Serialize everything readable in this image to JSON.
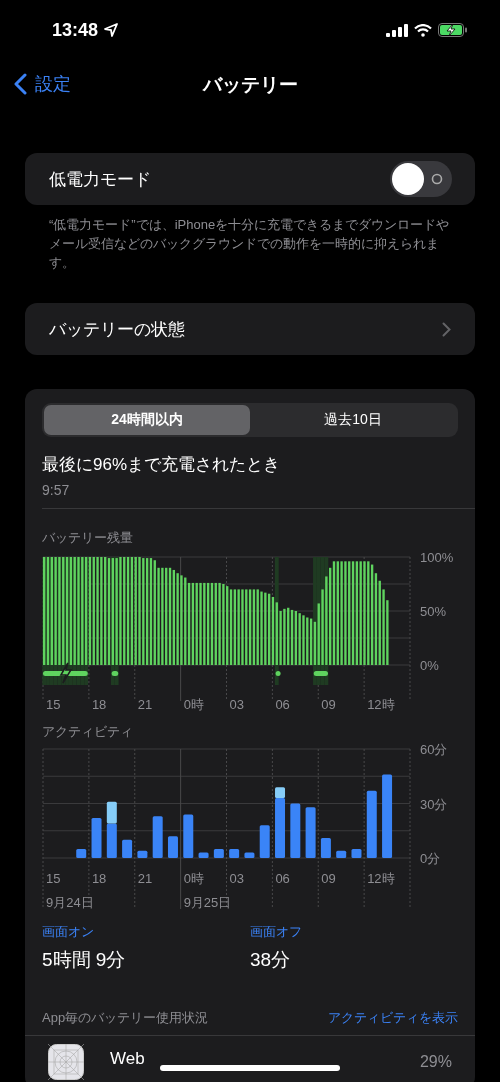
{
  "status_bar": {
    "time": "13:48"
  },
  "nav": {
    "back_label": "設定",
    "title": "バッテリー"
  },
  "low_power_mode": {
    "label": "低電力モード",
    "on": false,
    "footnote": "“低電力モード”では、iPhoneを十分に充電できるまでダウンロードやメール受信などのバックグラウンドでの動作を一時的に抑えられます。"
  },
  "battery_health": {
    "label": "バッテリーの状態"
  },
  "usage": {
    "tabs": [
      {
        "label": "24時間以内",
        "selected": true
      },
      {
        "label": "過去10日",
        "selected": false
      }
    ],
    "last_charged": {
      "title": "最後に96%まで充電されたとき",
      "time": "9:57"
    },
    "battery_level": {
      "title": "バッテリー残量",
      "x_labels": [
        "15",
        "18",
        "21",
        "0時",
        "03",
        "06",
        "09",
        "12時"
      ],
      "chart_data": {
        "type": "bar",
        "color": "#5fd35f",
        "values": [
          100,
          100,
          100,
          100,
          100,
          100,
          100,
          100,
          100,
          100,
          100,
          100,
          100,
          100,
          100,
          100,
          100,
          99,
          99,
          99,
          100,
          100,
          100,
          100,
          100,
          100,
          99,
          99,
          99,
          97,
          90,
          90,
          90,
          90,
          88,
          85,
          83,
          81,
          76,
          76,
          76,
          76,
          76,
          76,
          76,
          76,
          76,
          75,
          73,
          70,
          70,
          70,
          70,
          70,
          70,
          70,
          70,
          68,
          67,
          66,
          63,
          58,
          50,
          52,
          53,
          51,
          50,
          48,
          46,
          44,
          43,
          40,
          57,
          70,
          82,
          90,
          96,
          96,
          96,
          96,
          96,
          96,
          96,
          96,
          96,
          96,
          93,
          85,
          78,
          70,
          60
        ],
        "ylim": [
          0,
          100
        ],
        "yticks": [
          {
            "value": 0,
            "label": "0%"
          },
          {
            "value": 50,
            "label": "50%"
          },
          {
            "value": 100,
            "label": "100%"
          }
        ]
      },
      "charging": [
        true,
        true,
        true,
        true,
        true,
        true,
        true,
        true,
        true,
        true,
        true,
        true,
        false,
        false,
        false,
        false,
        false,
        false,
        true,
        true,
        false,
        false,
        false,
        false,
        false,
        false,
        false,
        false,
        false,
        false,
        false,
        false,
        false,
        false,
        false,
        false,
        false,
        false,
        false,
        false,
        false,
        false,
        false,
        false,
        false,
        false,
        false,
        false,
        false,
        false,
        false,
        false,
        false,
        false,
        false,
        false,
        false,
        false,
        false,
        false,
        false,
        true,
        false,
        false,
        false,
        false,
        false,
        false,
        false,
        false,
        false,
        true,
        true,
        true,
        true,
        false,
        false,
        false,
        false,
        false,
        false,
        false,
        false,
        false,
        false,
        false,
        false,
        false,
        false,
        false,
        false
      ]
    },
    "activity": {
      "title": "アクティビティ",
      "x_labels": [
        "15",
        "18",
        "21",
        "0時",
        "03",
        "06",
        "09",
        "12時"
      ],
      "chart_data": {
        "type": "bar",
        "stacked": true,
        "series": [
          {
            "name": "画面オン",
            "color": "#3a84f7",
            "values": [
              0,
              0,
              5,
              22,
              19,
              10,
              4,
              23,
              12,
              24,
              3,
              5,
              5,
              3,
              18,
              33,
              30,
              28,
              11,
              4,
              5,
              37,
              46,
              0
            ]
          },
          {
            "name": "画面オフ",
            "color": "#86cdf8",
            "values": [
              0,
              0,
              0,
              0,
              12,
              0,
              0,
              0,
              0,
              0,
              0,
              0,
              0,
              0,
              0,
              6,
              0,
              0,
              0,
              0,
              0,
              0,
              0,
              0
            ]
          }
        ],
        "ylim": [
          0,
          60
        ],
        "yticks": [
          {
            "value": 0,
            "label": "0分"
          },
          {
            "value": 30,
            "label": "30分"
          },
          {
            "value": 60,
            "label": "60分"
          }
        ]
      },
      "date_labels": [
        "9月24日",
        "9月25日"
      ]
    },
    "totals": [
      "5時間 9分",
      "38分"
    ],
    "apps_header": {
      "title": "App毎のバッテリー使用状況",
      "action": "アクティビティを表示"
    },
    "apps": [
      {
        "name": "Web",
        "percent": "29%"
      }
    ]
  }
}
